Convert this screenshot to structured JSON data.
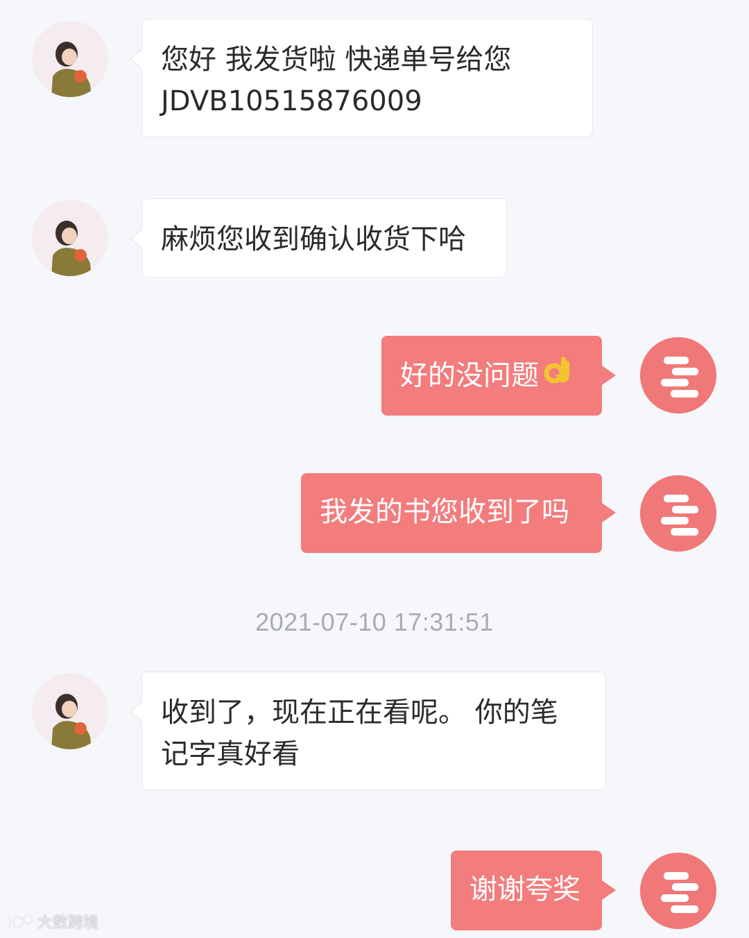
{
  "messages": [
    {
      "id": "m1",
      "side": "left",
      "text": "您好 我发货啦 快递单号给您\nJDVB10515876009"
    },
    {
      "id": "m2",
      "side": "left",
      "text": "麻烦您收到确认收货下哈"
    },
    {
      "id": "m3",
      "side": "right",
      "text": "好的没问题",
      "icon": "ok-hand-icon"
    },
    {
      "id": "m4",
      "side": "right",
      "text": "我发的书您收到了吗"
    },
    {
      "id": "m5",
      "side": "left",
      "text": "收到了，现在正在看呢。 你的笔\n记字真好看"
    },
    {
      "id": "m6",
      "side": "right",
      "text": "谢谢夸奖"
    }
  ],
  "timestamp": "2021-07-10 17:31:51",
  "watermark": "大数跨境",
  "colors": {
    "background": "#f6f7fb",
    "incoming_bubble": "#ffffff",
    "outgoing_bubble": "#f37c7d",
    "outgoing_text": "#ffffff",
    "incoming_text": "#2a2a2e",
    "timestamp_text": "#a9abb3",
    "seller_avatar": "#f07878"
  }
}
